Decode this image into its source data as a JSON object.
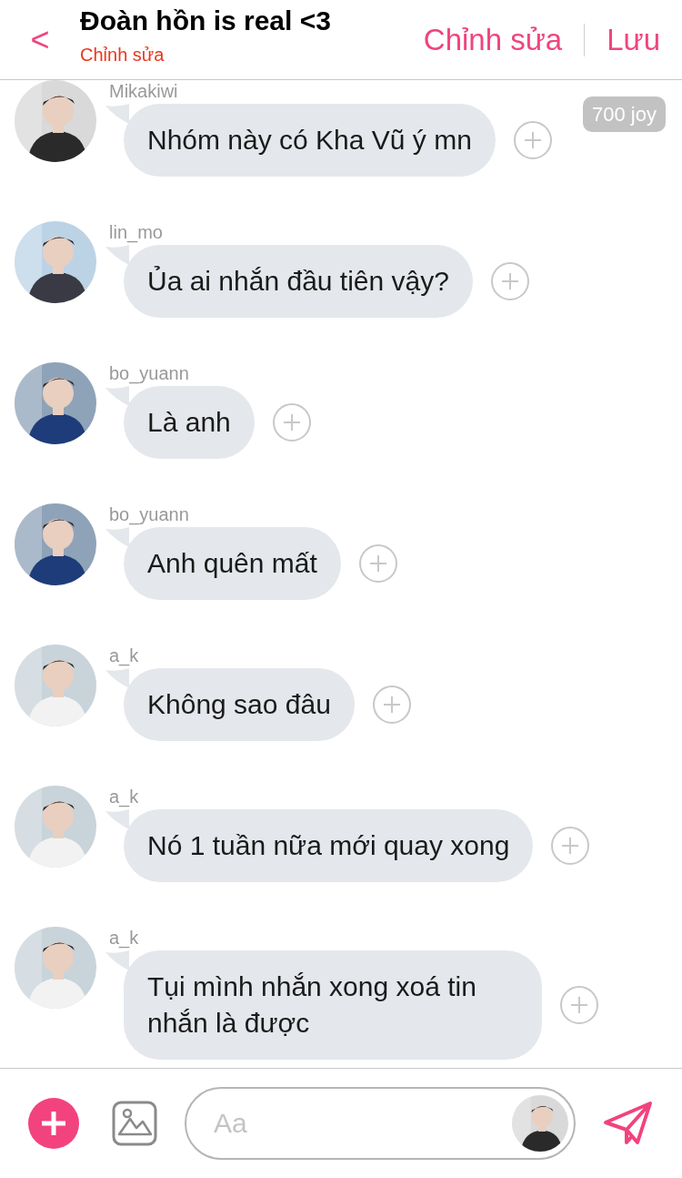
{
  "header": {
    "back": "<",
    "title": "Đoàn hồn is real <3",
    "subtitle": "Chỉnh sửa",
    "actions": [
      "Chỉnh sửa",
      "Lưu"
    ]
  },
  "messages": [
    {
      "username": "Mikakiwi",
      "text": "Nhóm này có Kha Vũ ý mn",
      "badge": "700 joy"
    },
    {
      "username": "lin_mo",
      "text": "Ủa ai nhắn đầu tiên vậy?"
    },
    {
      "username": "bo_yuann",
      "text": "Là anh"
    },
    {
      "username": "bo_yuann",
      "text": "Anh quên mất"
    },
    {
      "username": "a_k",
      "text": "Không sao đâu"
    },
    {
      "username": "a_k",
      "text": "Nó 1 tuần nữa mới quay xong"
    },
    {
      "username": "a_k",
      "text": "Tụi mình nhắn xong xoá tin nhắn là được"
    }
  ],
  "composer": {
    "placeholder": "Aa"
  }
}
